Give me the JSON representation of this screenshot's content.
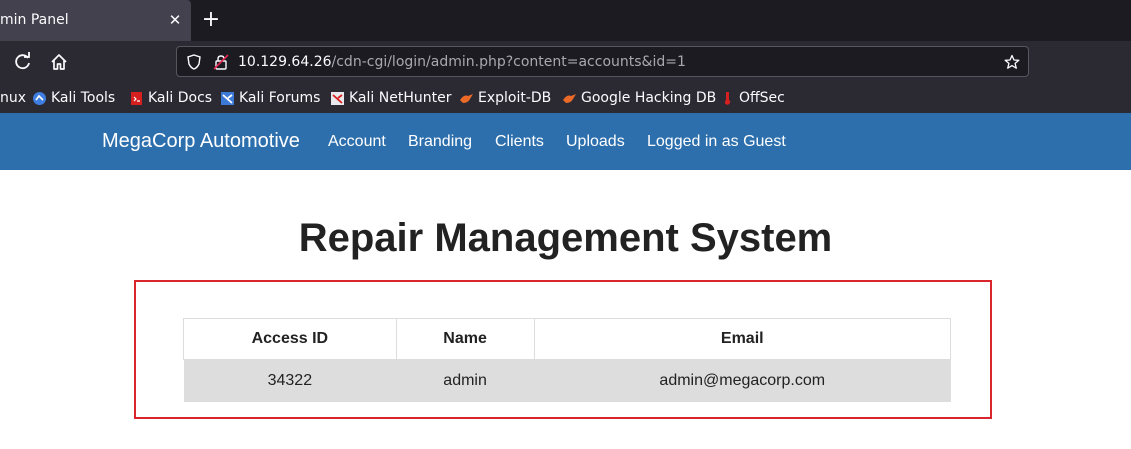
{
  "browser": {
    "tab_title": "min Panel",
    "tab_close": "✕",
    "new_tab": "+",
    "url_host": "10.129.64.26",
    "url_path": "/cdn-cgi/login/admin.php?content=accounts&id=1",
    "bookmarks": [
      {
        "label": "nux",
        "icon": "none"
      },
      {
        "label": "Kali Tools",
        "icon": "kali-tools-icon"
      },
      {
        "label": "Kali Docs",
        "icon": "kali-docs-icon"
      },
      {
        "label": "Kali Forums",
        "icon": "kali-forums-icon"
      },
      {
        "label": "Kali NetHunter",
        "icon": "kali-nethunter-icon"
      },
      {
        "label": "Exploit-DB",
        "icon": "exploit-db-icon"
      },
      {
        "label": "Google Hacking DB",
        "icon": "ghdb-icon"
      },
      {
        "label": "OffSec",
        "icon": "offsec-icon"
      }
    ]
  },
  "site": {
    "brand": "MegaCorp Automotive",
    "nav": [
      "Account",
      "Branding",
      "Clients",
      "Uploads",
      "Logged in as Guest"
    ]
  },
  "main": {
    "title": "Repair Management System",
    "table": {
      "headers": [
        "Access ID",
        "Name",
        "Email"
      ],
      "rows": [
        [
          "34322",
          "admin",
          "admin@megacorp.com"
        ]
      ]
    }
  },
  "colors": {
    "navbar": "#2d6fad",
    "highlight_box": "#d9262c",
    "row_bg": "#dddddd"
  }
}
